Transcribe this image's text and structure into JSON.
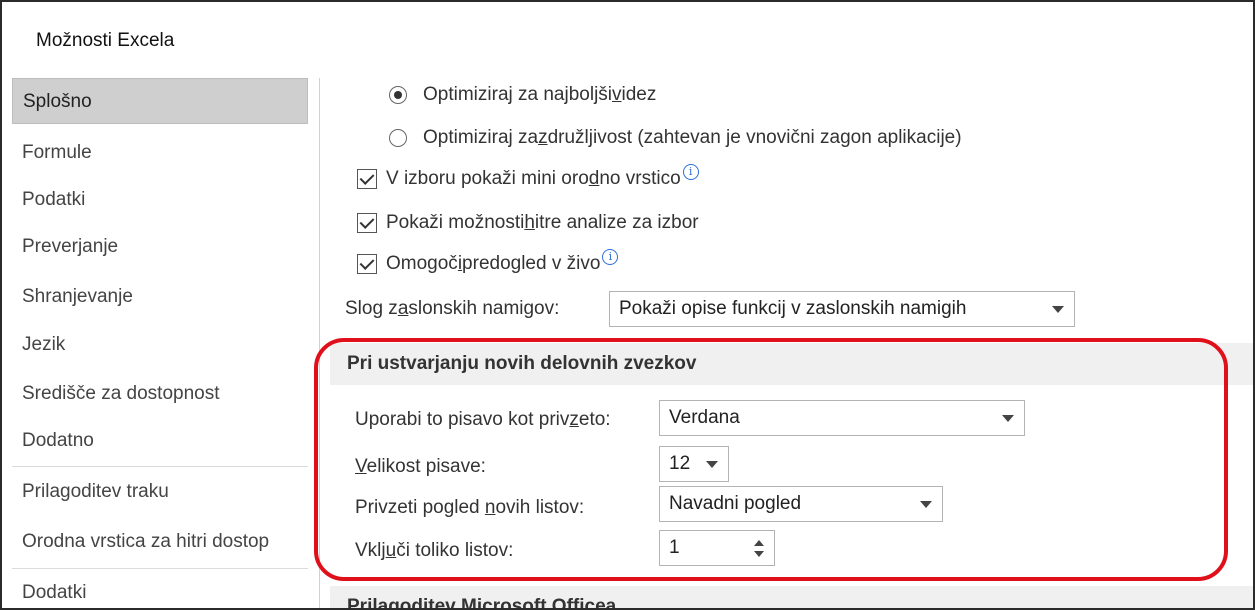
{
  "window": {
    "title": "Možnosti Excela"
  },
  "nav": {
    "items": [
      {
        "label": "Splošno",
        "selected": true
      },
      {
        "label": "Formule"
      },
      {
        "label": "Podatki"
      },
      {
        "label": "Preverjanje"
      },
      {
        "label": "Shranjevanje"
      },
      {
        "label": "Jezik"
      },
      {
        "label": "Središče za dostopnost"
      },
      {
        "label": "Dodatno"
      },
      {
        "label": "Prilagoditev traku"
      },
      {
        "label": "Orodna vrstica za hitri dostop"
      },
      {
        "label": "Dodatki"
      }
    ]
  },
  "ui_options": {
    "radio_best_look": {
      "pre": "Optimiziraj za najboljši ",
      "ul": "v",
      "post": "idez",
      "checked": true
    },
    "radio_compat": {
      "pre": "Optimiziraj za ",
      "ul": "z",
      "post": "družljivost (zahtevan je vnovični zagon aplikacije)",
      "checked": false
    },
    "mini_toolbar": {
      "pre": "V izboru pokaži mini oro",
      "ul": "d",
      "post": "no vrstico",
      "checked": true
    },
    "quick_analysis": {
      "pre": "Pokaži možnosti ",
      "ul": "h",
      "post": "itre analize za izbor",
      "checked": true
    },
    "live_preview": {
      "pre": "Omogoč",
      "ul": "i",
      "post": " predogled v živo",
      "checked": true
    },
    "info_glyph": "i",
    "screentip": {
      "label_pre": "Slog z",
      "label_ul": "a",
      "label_post": "slonskih namigov:",
      "value": "Pokaži opise funkcij v zaslonskih namigih"
    }
  },
  "new_workbooks": {
    "header": "Pri ustvarjanju novih delovnih zvezkov",
    "font": {
      "label_pre": "Uporabi to pisavo kot priv",
      "label_ul": "z",
      "label_post": "eto:",
      "value": "Verdana"
    },
    "size": {
      "label_pre": "",
      "label_ul": "V",
      "label_post": "elikost pisave:",
      "value": "12"
    },
    "view": {
      "label_pre": "Privzeti pogled ",
      "label_ul": "n",
      "label_post": "ovih listov:",
      "value": "Navadni pogled"
    },
    "sheets": {
      "label_pre": "Vklj",
      "label_ul": "u",
      "label_post": "či toliko listov:",
      "value": "1"
    }
  },
  "office_section": {
    "header": "Prilagoditev Microsoft Officea"
  },
  "colors": {
    "highlight": "#e0101a",
    "selected_nav": "#cfcfcf",
    "section_bg": "#f0f0f0"
  }
}
